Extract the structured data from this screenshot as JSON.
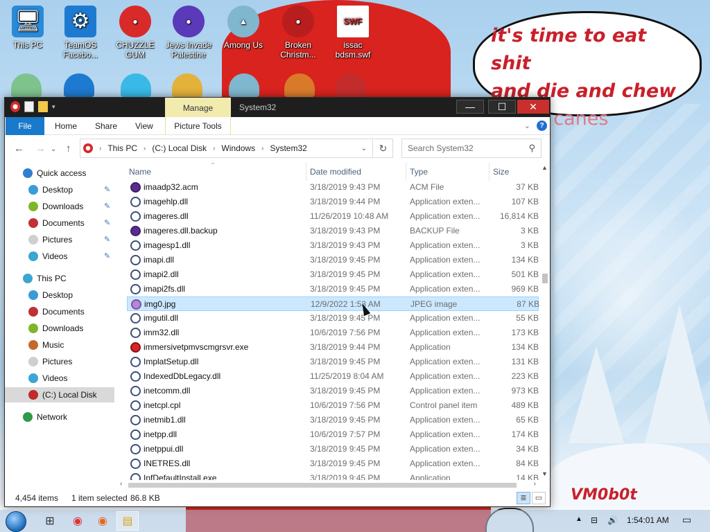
{
  "wallpaper": {
    "speech_lines": [
      "it's time to eat shit",
      "and die and chew"
    ],
    "speech_faded": "candy canes",
    "signature": "VM0b0t"
  },
  "desktop_icons": [
    {
      "label": "This PC",
      "icon": "computer-icon",
      "color": "#2a8ad8",
      "glyph": "🖥"
    },
    {
      "label": "TeamOS Facebo...",
      "icon": "gear-icon",
      "color": "#1e7ad0",
      "glyph": "⚙"
    },
    {
      "label": "CHUZZLE GUM",
      "icon": "chuzzle-icon",
      "color": "#d92a2a",
      "glyph": "●"
    },
    {
      "label": "Jews Invade Palestine",
      "icon": "ornament-icon",
      "color": "#5a3ab8",
      "glyph": "●"
    },
    {
      "label": "Among Us",
      "icon": "among-us-icon",
      "color": "#7fb7cf",
      "glyph": "▲"
    },
    {
      "label": "Broken Christm...",
      "icon": "ornament-icon",
      "color": "#b81e1e",
      "glyph": "●"
    },
    {
      "label": "issac bdsm.swf",
      "icon": "flash-file-icon",
      "color": "#ffffff",
      "glyph": "SWF"
    }
  ],
  "window": {
    "title": "System32",
    "manage_tab": "Manage",
    "ribbon_tabs": [
      "File",
      "Home",
      "Share",
      "View",
      "Picture Tools"
    ],
    "minimize": "—",
    "maximize": "☐",
    "close": "✕",
    "help": "?"
  },
  "address": {
    "segments": [
      "This PC",
      "(C:) Local Disk",
      "Windows",
      "System32"
    ],
    "search_placeholder": "Search System32"
  },
  "nav": [
    {
      "label": "Quick access",
      "color": "#2f7fd0",
      "pin": false,
      "indent": 1
    },
    {
      "label": "Desktop",
      "color": "#3a9bd8",
      "pin": true,
      "indent": 2
    },
    {
      "label": "Downloads",
      "color": "#7fb52a",
      "pin": true,
      "indent": 2
    },
    {
      "label": "Documents",
      "color": "#c03035",
      "pin": true,
      "indent": 2
    },
    {
      "label": "Pictures",
      "color": "#cfcfcf",
      "pin": true,
      "indent": 2
    },
    {
      "label": "Videos",
      "color": "#3aa6d1",
      "pin": true,
      "indent": 2
    },
    {
      "label": "This PC",
      "color": "#3aa6d1",
      "pin": false,
      "indent": 1
    },
    {
      "label": "Desktop",
      "color": "#3a9bd8",
      "pin": false,
      "indent": 2
    },
    {
      "label": "Documents",
      "color": "#c03035",
      "pin": false,
      "indent": 2
    },
    {
      "label": "Downloads",
      "color": "#7fb52a",
      "pin": false,
      "indent": 2
    },
    {
      "label": "Music",
      "color": "#c26a2a",
      "pin": false,
      "indent": 2
    },
    {
      "label": "Pictures",
      "color": "#cfcfcf",
      "pin": false,
      "indent": 2
    },
    {
      "label": "Videos",
      "color": "#3aa6d1",
      "pin": false,
      "indent": 2
    },
    {
      "label": "(C:) Local Disk",
      "color": "#c02a2a",
      "pin": false,
      "indent": 2,
      "selected": true
    },
    {
      "label": "Network",
      "color": "#2f9a4a",
      "pin": false,
      "indent": 1
    }
  ],
  "columns": {
    "name": "Name",
    "date": "Date modified",
    "type": "Type",
    "size": "Size"
  },
  "files": [
    {
      "name": "imaadp32.acm",
      "date": "3/18/2019 9:43 PM",
      "type": "ACM File",
      "size": "37 KB",
      "kind": "acm"
    },
    {
      "name": "imagehlp.dll",
      "date": "3/18/2019 9:44 PM",
      "type": "Application exten...",
      "size": "107 KB",
      "kind": "dll"
    },
    {
      "name": "imageres.dll",
      "date": "11/26/2019 10:48 AM",
      "type": "Application exten...",
      "size": "16,814 KB",
      "kind": "dll"
    },
    {
      "name": "imageres.dll.backup",
      "date": "3/18/2019 9:43 PM",
      "type": "BACKUP File",
      "size": "3 KB",
      "kind": "acm"
    },
    {
      "name": "imagesp1.dll",
      "date": "3/18/2019 9:43 PM",
      "type": "Application exten...",
      "size": "3 KB",
      "kind": "dll"
    },
    {
      "name": "imapi.dll",
      "date": "3/18/2019 9:45 PM",
      "type": "Application exten...",
      "size": "134 KB",
      "kind": "dll"
    },
    {
      "name": "imapi2.dll",
      "date": "3/18/2019 9:45 PM",
      "type": "Application exten...",
      "size": "501 KB",
      "kind": "dll"
    },
    {
      "name": "imapi2fs.dll",
      "date": "3/18/2019 9:45 PM",
      "type": "Application exten...",
      "size": "969 KB",
      "kind": "dll"
    },
    {
      "name": "img0.jpg",
      "date": "12/9/2022 1:53 AM",
      "type": "JPEG image",
      "size": "87 KB",
      "kind": "jpg",
      "selected": true
    },
    {
      "name": "imgutil.dll",
      "date": "3/18/2019 9:45 PM",
      "type": "Application exten...",
      "size": "55 KB",
      "kind": "dll"
    },
    {
      "name": "imm32.dll",
      "date": "10/6/2019 7:56 PM",
      "type": "Application exten...",
      "size": "173 KB",
      "kind": "dll"
    },
    {
      "name": "immersivetpmvscmgrsvr.exe",
      "date": "3/18/2019 9:44 PM",
      "type": "Application",
      "size": "134 KB",
      "kind": "exe"
    },
    {
      "name": "ImplatSetup.dll",
      "date": "3/18/2019 9:45 PM",
      "type": "Application exten...",
      "size": "131 KB",
      "kind": "dll"
    },
    {
      "name": "IndexedDbLegacy.dll",
      "date": "11/25/2019 8:04 AM",
      "type": "Application exten...",
      "size": "223 KB",
      "kind": "dll"
    },
    {
      "name": "inetcomm.dll",
      "date": "3/18/2019 9:45 PM",
      "type": "Application exten...",
      "size": "973 KB",
      "kind": "dll"
    },
    {
      "name": "inetcpl.cpl",
      "date": "10/6/2019 7:56 PM",
      "type": "Control panel item",
      "size": "489 KB",
      "kind": "dll"
    },
    {
      "name": "inetmib1.dll",
      "date": "3/18/2019 9:45 PM",
      "type": "Application exten...",
      "size": "65 KB",
      "kind": "dll"
    },
    {
      "name": "inetpp.dll",
      "date": "10/6/2019 7:57 PM",
      "type": "Application exten...",
      "size": "174 KB",
      "kind": "dll"
    },
    {
      "name": "inetppui.dll",
      "date": "3/18/2019 9:45 PM",
      "type": "Application exten...",
      "size": "34 KB",
      "kind": "dll"
    },
    {
      "name": "INETRES.dll",
      "date": "3/18/2019 9:45 PM",
      "type": "Application exten...",
      "size": "84 KB",
      "kind": "dll"
    },
    {
      "name": "InfDefaultInstall.exe",
      "date": "3/18/2019 9:45 PM",
      "type": "Application",
      "size": "14 KB",
      "kind": "dll"
    }
  ],
  "status": {
    "count": "4,454 items",
    "selection": "1 item selected",
    "size": "86.8 KB"
  },
  "taskbar": {
    "clock": "1:54:01 AM"
  }
}
